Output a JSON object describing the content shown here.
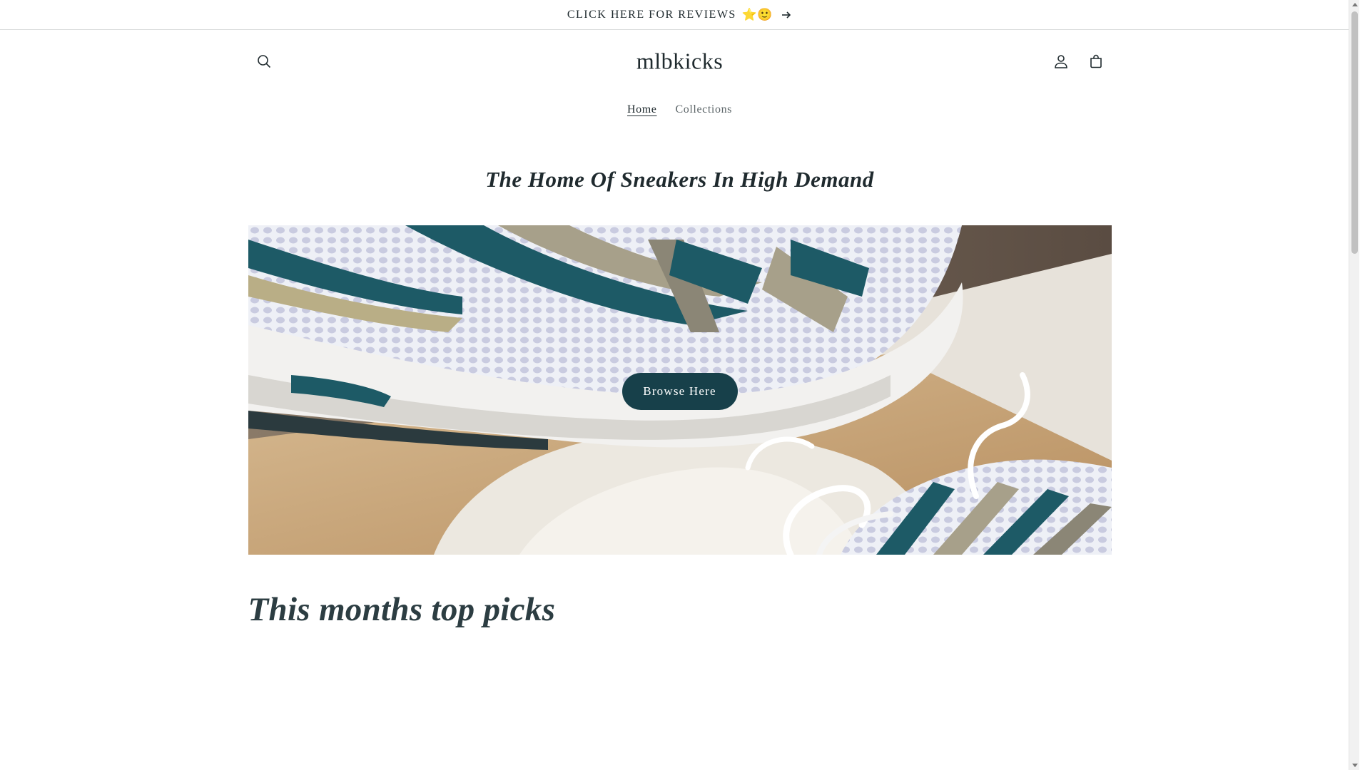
{
  "announcement": {
    "text": "CLICK HERE FOR REVIEWS",
    "emoji": "⭐🙂",
    "arrow_icon": "arrow-right-icon"
  },
  "header": {
    "logo": "mlbkicks",
    "icons": [
      "search-icon",
      "account-icon",
      "cart-icon"
    ]
  },
  "nav": {
    "items": [
      {
        "label": "Home",
        "active": true
      },
      {
        "label": "Collections",
        "active": false
      }
    ]
  },
  "hero": {
    "tagline": "The Home Of Sneakers In High Demand",
    "button_label": "Browse Here",
    "button_color": "#17404a"
  },
  "featured": {
    "title": "This months top picks"
  },
  "colors": {
    "text": "#1f2a2e",
    "accent": "#17404a",
    "sneaker_teal": "#1d5a66"
  }
}
